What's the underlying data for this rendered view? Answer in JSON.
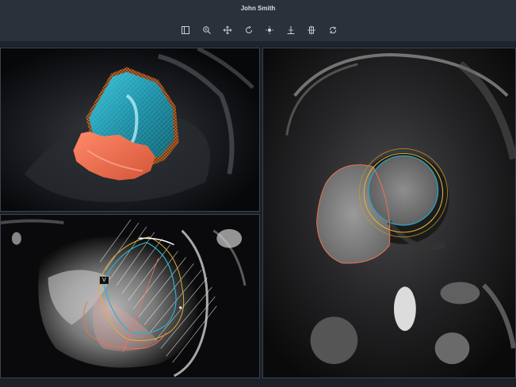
{
  "window": {
    "title": "John Smith"
  },
  "toolbar": {
    "tools": [
      {
        "icon": "layout-icon"
      },
      {
        "icon": "zoom-icon"
      },
      {
        "icon": "pan-icon"
      },
      {
        "icon": "rotate-icon"
      },
      {
        "icon": "brightness-icon"
      },
      {
        "icon": "crop-icon"
      },
      {
        "icon": "slice-icon"
      },
      {
        "icon": "reset-icon"
      }
    ]
  },
  "viewports": {
    "long_axis": {
      "marker_label": "V"
    }
  },
  "colors": {
    "lv_blue": "#2aa3b8",
    "rv_orange": "#f07052",
    "epi_mesh": "#e08a3a",
    "contour_yellow": "#e0b030"
  }
}
